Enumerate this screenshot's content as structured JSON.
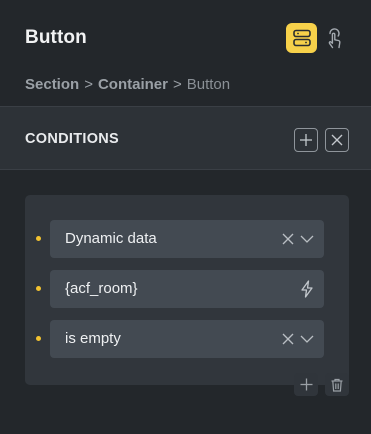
{
  "header": {
    "title": "Button",
    "layout_icon": "layout-toggle-icon",
    "interaction_icon": "hand-pointer-icon",
    "accent_color": "#f7d14a"
  },
  "breadcrumb": {
    "items": [
      "Section",
      "Container",
      "Button"
    ],
    "separator": ">"
  },
  "section": {
    "title": "CONDITIONS",
    "add_icon": "plus-icon",
    "remove_icon": "close-icon"
  },
  "conditions": {
    "bullet_color": "#f2c230",
    "rows": [
      {
        "value": "Dynamic data",
        "icons": [
          "clear-icon",
          "chevron-down-icon"
        ]
      },
      {
        "value": "{acf_room}",
        "icons": [
          "bolt-icon"
        ]
      },
      {
        "value": "is empty",
        "icons": [
          "clear-icon",
          "chevron-down-icon"
        ]
      }
    ],
    "actions": [
      "plus-icon",
      "trash-icon"
    ]
  }
}
